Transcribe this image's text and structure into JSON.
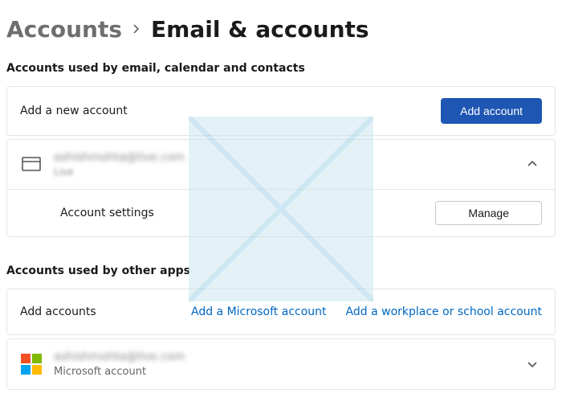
{
  "breadcrumb": {
    "parent": "Accounts",
    "current": "Email & accounts"
  },
  "section_email": {
    "title": "Accounts used by email, calendar and contacts",
    "add_new": {
      "label": "Add a new account",
      "button": "Add account"
    },
    "account": {
      "icon": "card-icon",
      "email_obscured": "ashishmohta@live.com",
      "provider_obscured": "Live",
      "expanded": true,
      "settings_label": "Account settings",
      "manage_button": "Manage"
    }
  },
  "section_apps": {
    "title": "Accounts used by other apps",
    "add_accounts_label": "Add accounts",
    "link_ms": "Add a Microsoft account",
    "link_work": "Add a workplace or school account",
    "account": {
      "icon": "microsoft-logo-icon",
      "email_obscured": "ashishmohta@live.com",
      "subtype": "Microsoft account",
      "expanded": false
    }
  },
  "colors": {
    "accent": "#1e56b3",
    "link": "#0067c0",
    "ms_red": "#f25022",
    "ms_green": "#7fba00",
    "ms_blue": "#00a4ef",
    "ms_yellow": "#ffb900"
  }
}
